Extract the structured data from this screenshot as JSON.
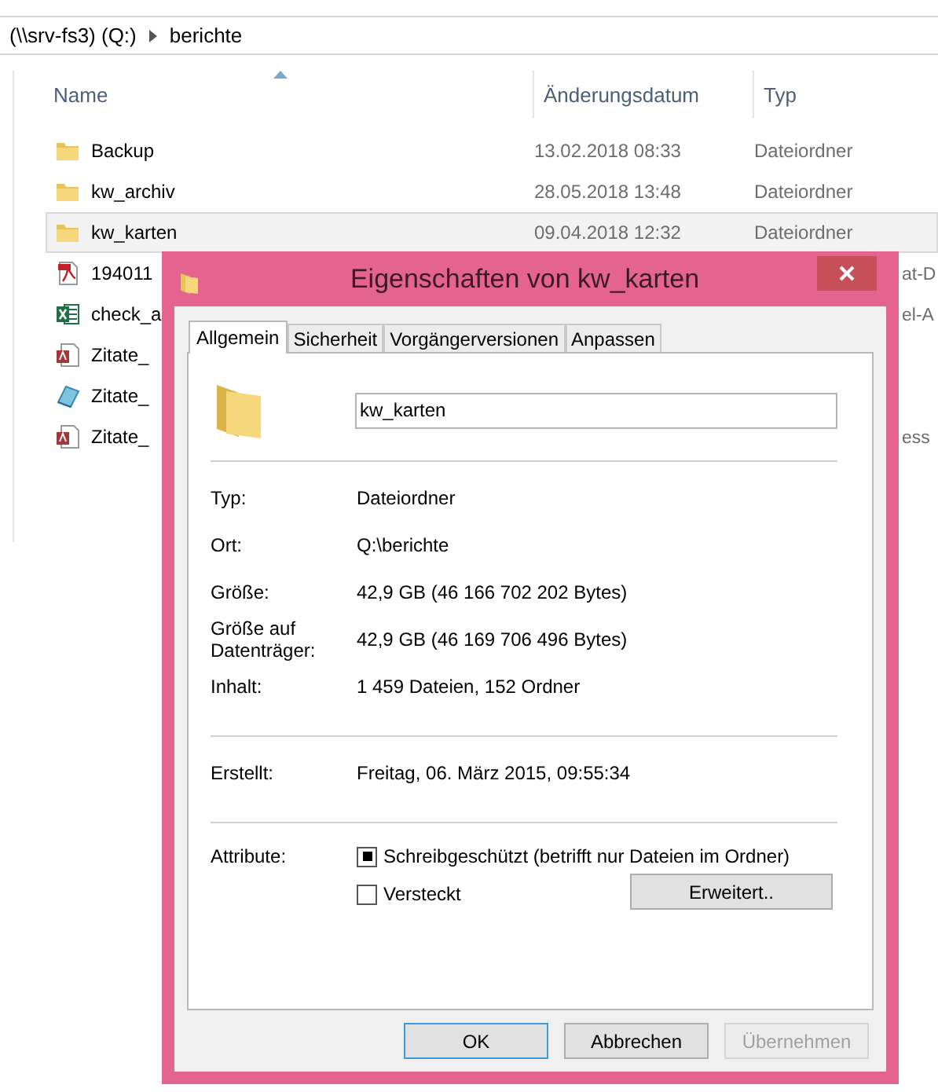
{
  "breadcrumb": [
    {
      "label": "(\\\\srv-fs3) (Q:)"
    },
    {
      "label": "berichte"
    }
  ],
  "columns": [
    {
      "label": "Name",
      "sorted": true
    },
    {
      "label": "Änderungsdatum",
      "sorted": false
    },
    {
      "label": "Typ",
      "sorted": false
    }
  ],
  "files": [
    {
      "kind": "folder",
      "name": "Backup",
      "date": "13.02.2018 08:33",
      "type": "Dateiordner",
      "selected": false
    },
    {
      "kind": "folder",
      "name": "kw_archiv",
      "date": "28.05.2018 13:48",
      "type": "Dateiordner",
      "selected": false
    },
    {
      "kind": "folder",
      "name": "kw_karten",
      "date": "09.04.2018 12:32",
      "type": "Dateiordner",
      "selected": true
    },
    {
      "kind": "pdf",
      "name": "194011",
      "type": "at-D",
      "selected": false
    },
    {
      "kind": "spreadsheet",
      "name": "check_a",
      "type": "el-A",
      "selected": false
    },
    {
      "kind": "database",
      "name": "Zitate_",
      "selected": false
    },
    {
      "kind": "ebook",
      "name": "Zitate_",
      "selected": false
    },
    {
      "kind": "database",
      "name": "Zitate_",
      "type": "ess",
      "selected": false
    }
  ],
  "dialog": {
    "title": "Eigenschaften von kw_karten",
    "tabs": [
      {
        "label": "Allgemein",
        "selected": true
      },
      {
        "label": "Sicherheit",
        "selected": false
      },
      {
        "label": "Vorgängerversionen",
        "selected": false
      },
      {
        "label": "Anpassen",
        "selected": false
      }
    ],
    "name_field": "kw_karten",
    "sections": [
      [
        {
          "label": "Typ:",
          "value": "Dateiordner"
        },
        {
          "label": "Ort:",
          "value": "Q:\\berichte"
        },
        {
          "label": "Größe:",
          "value": "42,9 GB (46 166 702 202 Bytes)"
        },
        {
          "label": "Größe auf Datenträger:",
          "value": "42,9 GB (46 169 706 496 Bytes)"
        },
        {
          "label": "Inhalt:",
          "value": "1 459 Dateien, 152 Ordner"
        }
      ],
      [
        {
          "label": "Erstellt:",
          "value": "Freitag, 06. März 2015, 09:55:34"
        }
      ]
    ],
    "attributes_label": "Attribute:",
    "attributes": [
      {
        "label": "Schreibgeschützt (betrifft nur Dateien im Ordner)",
        "checked": true
      },
      {
        "label": "Versteckt",
        "checked": false
      }
    ],
    "advanced_button": "Erweitert..",
    "buttons": [
      {
        "label": "OK",
        "default": true,
        "disabled": false
      },
      {
        "label": "Abbrechen",
        "default": false,
        "disabled": false
      },
      {
        "label": "Übernehmen",
        "default": false,
        "disabled": true
      }
    ]
  }
}
